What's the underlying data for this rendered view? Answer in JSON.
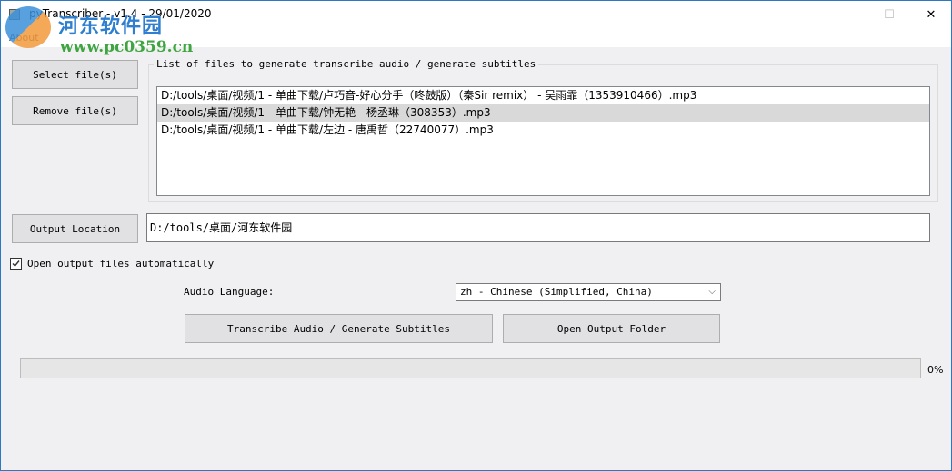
{
  "window": {
    "title": "pyTranscriber - v1.4 - 29/01/2020",
    "controls": {
      "minimize": "—",
      "maximize": "☐",
      "close": "✕"
    }
  },
  "menubar": {
    "items": [
      {
        "label": "About"
      }
    ]
  },
  "watermark": {
    "brand": "河东软件园",
    "url": "www.pc0359.cn"
  },
  "files": {
    "select_label": "Select file(s)",
    "remove_label": "Remove file(s)",
    "group_title": "List of files to generate transcribe audio / generate subtitles",
    "items": [
      {
        "path": "D:/tools/桌面/视频/1 - 单曲下载/卢巧音-好心分手（咚鼓版）（秦Sir remix） - 吴雨霏（1353910466）.mp3",
        "selected": false
      },
      {
        "path": "D:/tools/桌面/视频/1 - 单曲下载/钟无艳 - 杨丞琳（308353）.mp3",
        "selected": true
      },
      {
        "path": "D:/tools/桌面/视频/1 - 单曲下载/左边 - 唐禹哲（22740077）.mp3",
        "selected": false
      }
    ]
  },
  "output": {
    "button_label": "Output Location",
    "path": "D:/tools/桌面/河东软件园",
    "open_auto_label": "Open output files automatically",
    "open_auto_checked": true
  },
  "language": {
    "label": "Audio Language:",
    "selected": "zh - Chinese (Simplified, China)"
  },
  "actions": {
    "transcribe_label": "Transcribe Audio / Generate Subtitles",
    "open_folder_label": "Open Output Folder"
  },
  "progress": {
    "value_percent": 0,
    "text": "0%"
  }
}
